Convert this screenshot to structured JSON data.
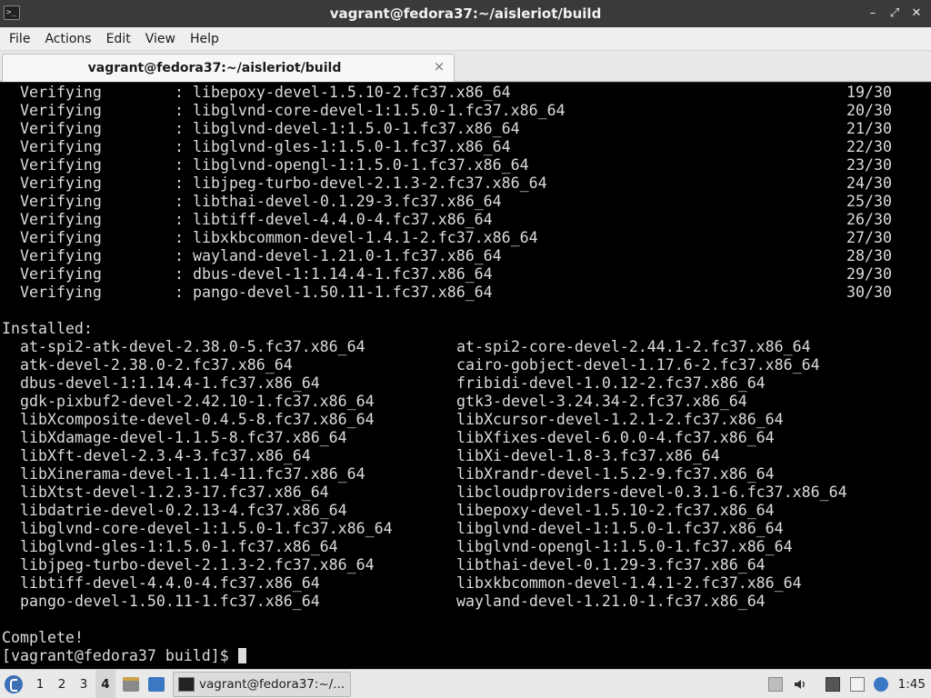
{
  "window": {
    "title": "vagrant@fedora37:~/aisleriot/build",
    "minimize_icon": "–",
    "maximize_icon": "⤢",
    "close_icon": "✕",
    "app_icon_text": ">_"
  },
  "menu": [
    "File",
    "Actions",
    "Edit",
    "View",
    "Help"
  ],
  "tab": {
    "label": "vagrant@fedora37:~/aisleriot/build",
    "close_icon": "×"
  },
  "terminal": {
    "verifying": [
      {
        "action": "Verifying",
        "pkg": "libepoxy-devel-1.5.10-2.fc37.x86_64",
        "count": "19/30"
      },
      {
        "action": "Verifying",
        "pkg": "libglvnd-core-devel-1:1.5.0-1.fc37.x86_64",
        "count": "20/30"
      },
      {
        "action": "Verifying",
        "pkg": "libglvnd-devel-1:1.5.0-1.fc37.x86_64",
        "count": "21/30"
      },
      {
        "action": "Verifying",
        "pkg": "libglvnd-gles-1:1.5.0-1.fc37.x86_64",
        "count": "22/30"
      },
      {
        "action": "Verifying",
        "pkg": "libglvnd-opengl-1:1.5.0-1.fc37.x86_64",
        "count": "23/30"
      },
      {
        "action": "Verifying",
        "pkg": "libjpeg-turbo-devel-2.1.3-2.fc37.x86_64",
        "count": "24/30"
      },
      {
        "action": "Verifying",
        "pkg": "libthai-devel-0.1.29-3.fc37.x86_64",
        "count": "25/30"
      },
      {
        "action": "Verifying",
        "pkg": "libtiff-devel-4.4.0-4.fc37.x86_64",
        "count": "26/30"
      },
      {
        "action": "Verifying",
        "pkg": "libxkbcommon-devel-1.4.1-2.fc37.x86_64",
        "count": "27/30"
      },
      {
        "action": "Verifying",
        "pkg": "wayland-devel-1.21.0-1.fc37.x86_64",
        "count": "28/30"
      },
      {
        "action": "Verifying",
        "pkg": "dbus-devel-1:1.14.4-1.fc37.x86_64",
        "count": "29/30"
      },
      {
        "action": "Verifying",
        "pkg": "pango-devel-1.50.11-1.fc37.x86_64",
        "count": "30/30"
      }
    ],
    "installed_header": "Installed:",
    "installed": [
      [
        "at-spi2-atk-devel-2.38.0-5.fc37.x86_64",
        "at-spi2-core-devel-2.44.1-2.fc37.x86_64"
      ],
      [
        "atk-devel-2.38.0-2.fc37.x86_64",
        "cairo-gobject-devel-1.17.6-2.fc37.x86_64"
      ],
      [
        "dbus-devel-1:1.14.4-1.fc37.x86_64",
        "fribidi-devel-1.0.12-2.fc37.x86_64"
      ],
      [
        "gdk-pixbuf2-devel-2.42.10-1.fc37.x86_64",
        "gtk3-devel-3.24.34-2.fc37.x86_64"
      ],
      [
        "libXcomposite-devel-0.4.5-8.fc37.x86_64",
        "libXcursor-devel-1.2.1-2.fc37.x86_64"
      ],
      [
        "libXdamage-devel-1.1.5-8.fc37.x86_64",
        "libXfixes-devel-6.0.0-4.fc37.x86_64"
      ],
      [
        "libXft-devel-2.3.4-3.fc37.x86_64",
        "libXi-devel-1.8-3.fc37.x86_64"
      ],
      [
        "libXinerama-devel-1.1.4-11.fc37.x86_64",
        "libXrandr-devel-1.5.2-9.fc37.x86_64"
      ],
      [
        "libXtst-devel-1.2.3-17.fc37.x86_64",
        "libcloudproviders-devel-0.3.1-6.fc37.x86_64"
      ],
      [
        "libdatrie-devel-0.2.13-4.fc37.x86_64",
        "libepoxy-devel-1.5.10-2.fc37.x86_64"
      ],
      [
        "libglvnd-core-devel-1:1.5.0-1.fc37.x86_64",
        "libglvnd-devel-1:1.5.0-1.fc37.x86_64"
      ],
      [
        "libglvnd-gles-1:1.5.0-1.fc37.x86_64",
        "libglvnd-opengl-1:1.5.0-1.fc37.x86_64"
      ],
      [
        "libjpeg-turbo-devel-2.1.3-2.fc37.x86_64",
        "libthai-devel-0.1.29-3.fc37.x86_64"
      ],
      [
        "libtiff-devel-4.4.0-4.fc37.x86_64",
        "libxkbcommon-devel-1.4.1-2.fc37.x86_64"
      ],
      [
        "pango-devel-1.50.11-1.fc37.x86_64",
        "wayland-devel-1.21.0-1.fc37.x86_64"
      ]
    ],
    "complete": "Complete!",
    "prompt": "[vagrant@fedora37 build]$ "
  },
  "taskbar": {
    "workspaces": [
      "1",
      "2",
      "3",
      "4"
    ],
    "active_workspace": "4",
    "task_label": "vagrant@fedora37:~/...",
    "clock": "1:45",
    "icons": [
      "fedora-menu-icon",
      "file-manager-icon",
      "desktop-icon",
      "terminal-icon",
      "network-icon",
      "volume-icon",
      "display-icon",
      "clipboard-icon",
      "notification-icon"
    ]
  }
}
